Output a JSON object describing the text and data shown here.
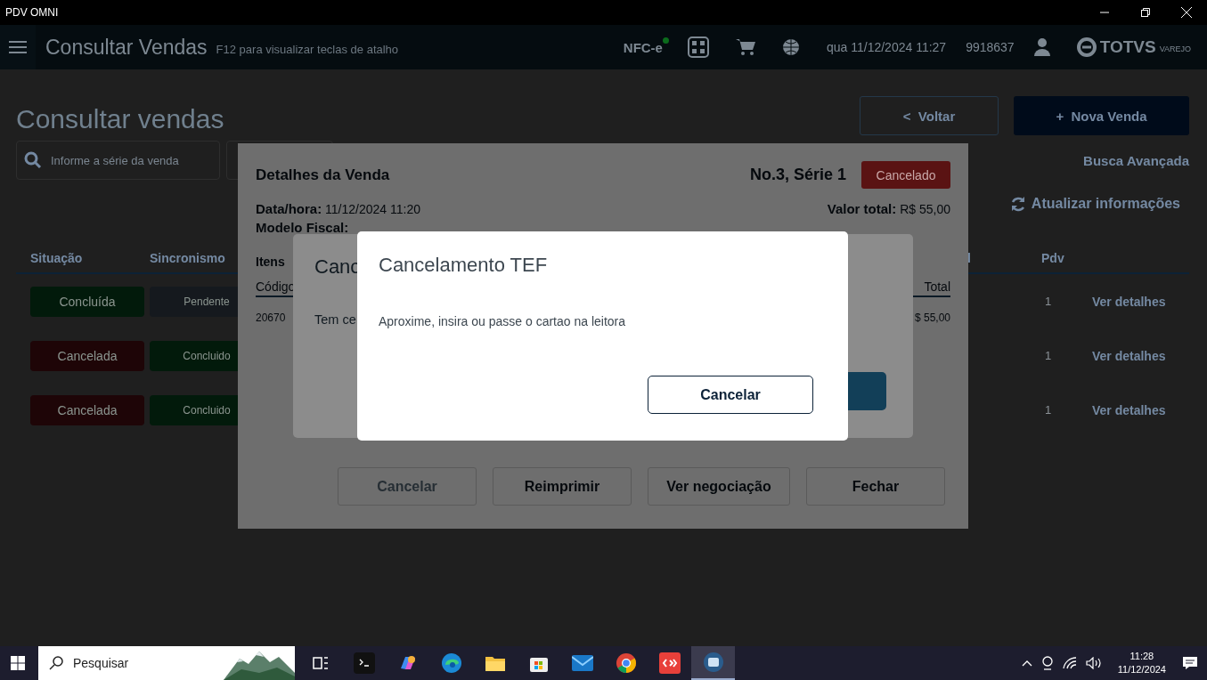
{
  "window": {
    "title": "PDV OMNI"
  },
  "header": {
    "title": "Consultar Vendas",
    "hint": "F12 para visualizar teclas de atalho",
    "nfce": "NFC-e",
    "nfce_online": true,
    "datetime": "qua 11/12/2024 11:27",
    "operator": "9918637",
    "logo": "TOTVS",
    "logo_sub": "VAREJO"
  },
  "page": {
    "title": "Consultar vendas",
    "back_button": "<  Voltar",
    "new_button": "+  Nova Venda",
    "search": {
      "placeholder": "Informe a série da venda"
    },
    "advanced_search": "Busca Avançada",
    "refresh": "Atualizar informações"
  },
  "table": {
    "columns": [
      "Situação",
      "Sincronismo",
      "l",
      "Pdv"
    ],
    "rows": [
      {
        "situacao": {
          "text": "Concluída",
          "color": "#021a0b"
        },
        "sincronismo": {
          "text": "Pendente",
          "color": "#15191e"
        },
        "pdv": "1",
        "action": "Ver detalhes"
      },
      {
        "situacao": {
          "text": "Cancelada",
          "color": "#1e0507"
        },
        "sincronismo": {
          "text": "Concluido",
          "color": "#021a0b"
        },
        "pdv": "1",
        "action": "Ver detalhes"
      },
      {
        "situacao": {
          "text": "Cancelada",
          "color": "#1e0507"
        },
        "sincronismo": {
          "text": "Concluido",
          "color": "#021a0b"
        },
        "pdv": "1",
        "action": "Ver detalhes"
      }
    ]
  },
  "details_dialog": {
    "title": "Detalhes da Venda",
    "number": "No.3, Série 1",
    "status": "Cancelado",
    "datetime": "**Data/hora:** 11/12/2024 11:20",
    "total": "**Valor total:** R$ 55,00",
    "fiscal_model": "Modelo Fiscal:",
    "items_label": "Itens",
    "columns": [
      "Código",
      "Total"
    ],
    "item_code": "20670",
    "item_total": "$ 55,00",
    "buttons": [
      {
        "label": "Cancelar",
        "disabled": true
      },
      {
        "label": "Reimprimir",
        "disabled": false
      },
      {
        "label": "Ver negociação",
        "disabled": false
      },
      {
        "label": "Fechar",
        "disabled": false
      }
    ]
  },
  "confirm_dialog": {
    "title": "Canc",
    "message": "Tem ce"
  },
  "tef_dialog": {
    "title": "Cancelamento TEF",
    "message": "Aproxime, insira ou passe o cartao na leitora",
    "button": "Cancelar"
  },
  "taskbar": {
    "search": {
      "placeholder": "Pesquisar"
    },
    "apps": [
      {
        "kind": "taskview",
        "selected": false
      },
      {
        "kind": "terminal",
        "selected": false
      },
      {
        "kind": "copilot",
        "selected": false
      },
      {
        "kind": "edge",
        "selected": false
      },
      {
        "kind": "folder",
        "selected": false
      },
      {
        "kind": "store",
        "selected": false
      },
      {
        "kind": "mail",
        "selected": false
      },
      {
        "kind": "chrome",
        "selected": false
      },
      {
        "kind": "remote",
        "selected": false
      },
      {
        "kind": "pdv",
        "selected": true
      }
    ],
    "time": "11:28",
    "date": "11/12/2024"
  }
}
